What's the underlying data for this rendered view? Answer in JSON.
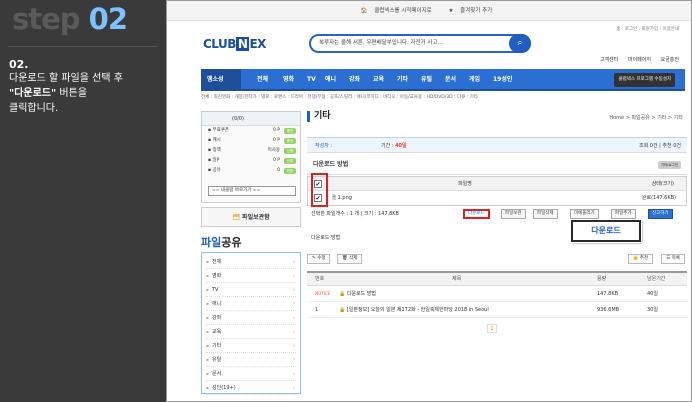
{
  "tutorial": {
    "step_word": "step",
    "step_num": "02",
    "instr_num": "02.",
    "instr_line1": "다운로드 할 파일을 선택 후",
    "instr_bold": "\"다운로드\"",
    "instr_line2": " 버튼을",
    "instr_line3": "클릭합니다."
  },
  "topbar": {
    "start_page": "클럽넥스를 시작페이지로",
    "favorite": "즐겨찾기 추가"
  },
  "util_links": "홈 : 로그인 : 회원가입 : 이용안내",
  "logo": {
    "part1": "CLUB",
    "part2": "N",
    "part3": "EX"
  },
  "search": {
    "text": "복루자는 올해 서른, 우편배달부입니다. 자전거 사고...",
    "icon": "search-icon"
  },
  "sublinks": [
    "고객센터",
    "마이페이지",
    "요금충전"
  ],
  "gnb": {
    "membership": "멤소성",
    "items": [
      "전체",
      "영화",
      "TV",
      "애니",
      "강좌",
      "교육",
      "기타",
      "유틸",
      "문서",
      "게임",
      "19성인"
    ],
    "program_btn": "클럽넥스 프로그램 수동설치"
  },
  "lnb": "전체 : 최신영화 : 개봉/한다가 : 별로 : 로맨스 : 드라마 : 전쟁/무협 : 공포/스릴러 : 애니/코미디 : 비디오 : 아동/교육용 : HD/DVD/3D : 다큐 : 기타",
  "mypanel": {
    "header": "(0/0)",
    "rows": [
      {
        "label": "무료쿠폰",
        "value": "0 P",
        "badge": "충전"
      },
      {
        "label": "캐시",
        "value": "0 P",
        "badge": "충전"
      },
      {
        "label": "정액",
        "value": "미사용",
        "badge": "신청"
      },
      {
        "label": "일P",
        "value": "0 P",
        "badge": "신청"
      },
      {
        "label": "공유",
        "value": "0",
        "badge": "변환"
      }
    ],
    "select": "== 내클럽 바로가기 =="
  },
  "filebox_label": "파일보관함",
  "share_title": {
    "blue": "파일",
    "dark": "공유"
  },
  "categories": [
    "전체",
    "영화",
    "TV",
    "애니",
    "강좌",
    "교육",
    "기타",
    "유틸",
    "문서",
    "성인(19+)"
  ],
  "main": {
    "title": "기타",
    "breadcrumb": "Home > 파일공유 > 기타 > 기타",
    "info": {
      "author_label": "작성자 :",
      "period": "기간 : ",
      "period_val": "40일",
      "right": "조회 0건 | 추천 0건"
    },
    "doc_title": "다운로드 방법",
    "doc_tag": "기타/로그인",
    "table": {
      "col_name": "파일명",
      "col_status": "상태(크기)",
      "file_name": "1.png",
      "file_status": "완료(147.6KB)"
    },
    "actions": {
      "summary": "선택한 파일개수 : 1 개 | 크기 : 147.8KB",
      "buttons": [
        "다운로드",
        "파일보관",
        "파일삭제",
        "미에올리기",
        "파일추가",
        "신고하기"
      ]
    },
    "callout": "다운로드",
    "desc": "다운로드 방법",
    "controls": {
      "edit": "수정",
      "delete": "삭제",
      "recommend": "추천",
      "list": "목록"
    },
    "list_headers": [
      "번호",
      "제목",
      "용량",
      "남은기간"
    ],
    "list_rows": [
      {
        "no": "",
        "notice": "NOTICE",
        "title": "다운로드 방법",
        "size": "147.8KB",
        "days": "40일"
      },
      {
        "no": "1",
        "notice": "",
        "title": "[일본정보] 오늘의 일본 제172화 - 한일축제한마당 2018 in Seoul",
        "size": "936.6MB",
        "days": "30일"
      }
    ],
    "page": "1"
  }
}
